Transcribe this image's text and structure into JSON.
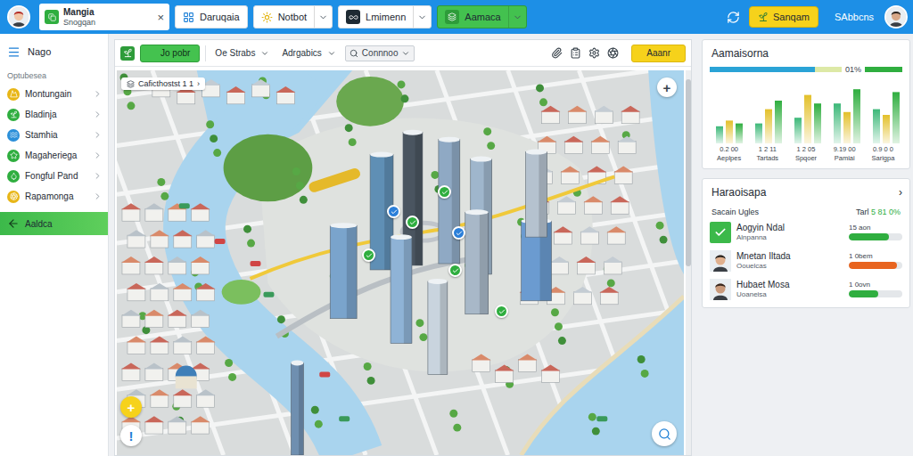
{
  "account": {
    "name": "Mangia",
    "subtitle": "Snogqan",
    "close": "×"
  },
  "tabs": [
    {
      "label": "Daruqaia",
      "selected": false,
      "dropdown": false
    },
    {
      "label": "Notbot",
      "selected": false,
      "dropdown": true
    },
    {
      "label": "Lmimenn",
      "selected": false,
      "dropdown": true
    },
    {
      "label": "Aamaca",
      "selected": true,
      "dropdown": true
    }
  ],
  "header_actions": {
    "button": "Sanqam",
    "user": "SAbbcns"
  },
  "sidebar": {
    "title": "Nago",
    "section": "Optubesea",
    "items": [
      {
        "label": "Montungain",
        "color": "#e8b617",
        "selected": false
      },
      {
        "label": "Bladinja",
        "color": "#2fae3f",
        "selected": false
      },
      {
        "label": "Stamhia",
        "color": "#2b8fd9",
        "selected": false
      },
      {
        "label": "Magaheriega",
        "color": "#2fae3f",
        "selected": false
      },
      {
        "label": "Fongful Pand",
        "color": "#2fae3f",
        "selected": false
      },
      {
        "label": "Rapamonga",
        "color": "#e8b617",
        "selected": false
      },
      {
        "label": "Aaldca",
        "color": "#2fae3f",
        "selected": true
      }
    ]
  },
  "toolbar": {
    "primary": "Jo pobr",
    "filters": [
      "Oe Strabs",
      "Adrgabics"
    ],
    "search": "Connnoo",
    "action": "Aaanr"
  },
  "map": {
    "info": {
      "label": "Caficthostst 1 1",
      "chevron": "›"
    },
    "zoom_in": "+",
    "add": "+",
    "alert": "!",
    "pins": [
      {
        "color": "#2fae3f"
      },
      {
        "color": "#2b7fd9"
      },
      {
        "color": "#2fae3f"
      },
      {
        "color": "#2b7fd9"
      },
      {
        "color": "#2fae3f"
      },
      {
        "color": "#2fae3f"
      },
      {
        "color": "#2fae3f"
      }
    ]
  },
  "summary": {
    "title": "Aamaisorna",
    "progress": {
      "segments": [
        {
          "level": 0.8,
          "color": "#2aa3d6"
        },
        {
          "level": 0.2,
          "color": "#dde9a6"
        }
      ],
      "reading": "01%",
      "target_level": 1
    },
    "chart": {
      "max": 100,
      "series": [
        {
          "color": "#3cb878",
          "values": [
            30,
            35,
            45,
            70,
            60
          ]
        },
        {
          "color": "#e3c02a",
          "values": [
            40,
            60,
            85,
            55,
            50
          ]
        },
        {
          "color": "#2fae3f",
          "values": [
            35,
            75,
            70,
            95,
            90
          ]
        }
      ],
      "values_row": [
        "0.2 00",
        "1 2 11",
        "1 2 05",
        "9.19 00",
        "0.9 0 0"
      ],
      "categories": [
        "Aeplpes",
        "Tartads",
        "Spqoer",
        "Pamiai",
        "Sarigpa"
      ]
    }
  },
  "list": {
    "title": "Haraoisapa",
    "chevron": "›",
    "subtitle": "Sacain Ugles",
    "total": {
      "label": "Tarl",
      "value": "5 81 0%"
    },
    "rows": [
      {
        "kind": "icon",
        "name": "Aogyin Ndal",
        "detail": "Alnpanna",
        "reading": "15 aon",
        "level": 0.75,
        "color": "#2fae3f"
      },
      {
        "kind": "avatar",
        "name": "Mnetan Iltada",
        "detail": "Oouelcas",
        "reading": "1 0bem",
        "level": 0.9,
        "color": "#e8641f"
      },
      {
        "kind": "avatar",
        "name": "Hubaet Mosa",
        "detail": "Uoaneisa",
        "reading": "1 0ovn",
        "level": 0.55,
        "color": "#2fae3f"
      }
    ]
  }
}
